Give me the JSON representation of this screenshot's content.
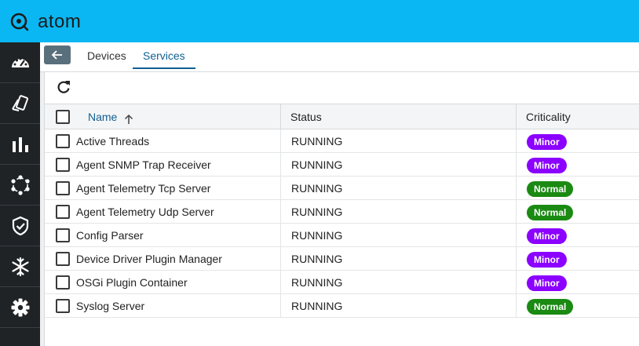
{
  "app": {
    "logo_text": "atom"
  },
  "sidebar": {
    "items": [
      {
        "icon": "dashboard-gauge-icon"
      },
      {
        "icon": "devices-cards-icon"
      },
      {
        "icon": "bar-chart-icon"
      },
      {
        "icon": "network-nodes-icon"
      },
      {
        "icon": "shield-check-icon"
      },
      {
        "icon": "snowflake-icon"
      },
      {
        "icon": "gear-icon"
      }
    ]
  },
  "tabs": {
    "back_icon": "arrow-left-icon",
    "devices": "Devices",
    "services": "Services",
    "active": "Services"
  },
  "table": {
    "headers": {
      "name": "Name",
      "status": "Status",
      "criticality": "Criticality"
    },
    "sort": {
      "column": "Name",
      "direction": "ascending"
    },
    "rows": [
      {
        "name": "Active Threads",
        "status": "RUNNING",
        "criticality": "Minor"
      },
      {
        "name": "Agent SNMP Trap Receiver",
        "status": "RUNNING",
        "criticality": "Minor"
      },
      {
        "name": "Agent Telemetry Tcp Server",
        "status": "RUNNING",
        "criticality": "Normal"
      },
      {
        "name": "Agent Telemetry Udp Server",
        "status": "RUNNING",
        "criticality": "Normal"
      },
      {
        "name": "Config Parser",
        "status": "RUNNING",
        "criticality": "Minor"
      },
      {
        "name": "Device Driver Plugin Manager",
        "status": "RUNNING",
        "criticality": "Minor"
      },
      {
        "name": "OSGi Plugin Container",
        "status": "RUNNING",
        "criticality": "Minor"
      },
      {
        "name": "Syslog Server",
        "status": "RUNNING",
        "criticality": "Normal"
      }
    ]
  },
  "colors": {
    "topbar": "#0ab7f3",
    "sidebar": "#1f2326",
    "active_tab": "#0f5f92",
    "minor_badge": "#8b00ff",
    "normal_badge": "#1a8a12"
  }
}
